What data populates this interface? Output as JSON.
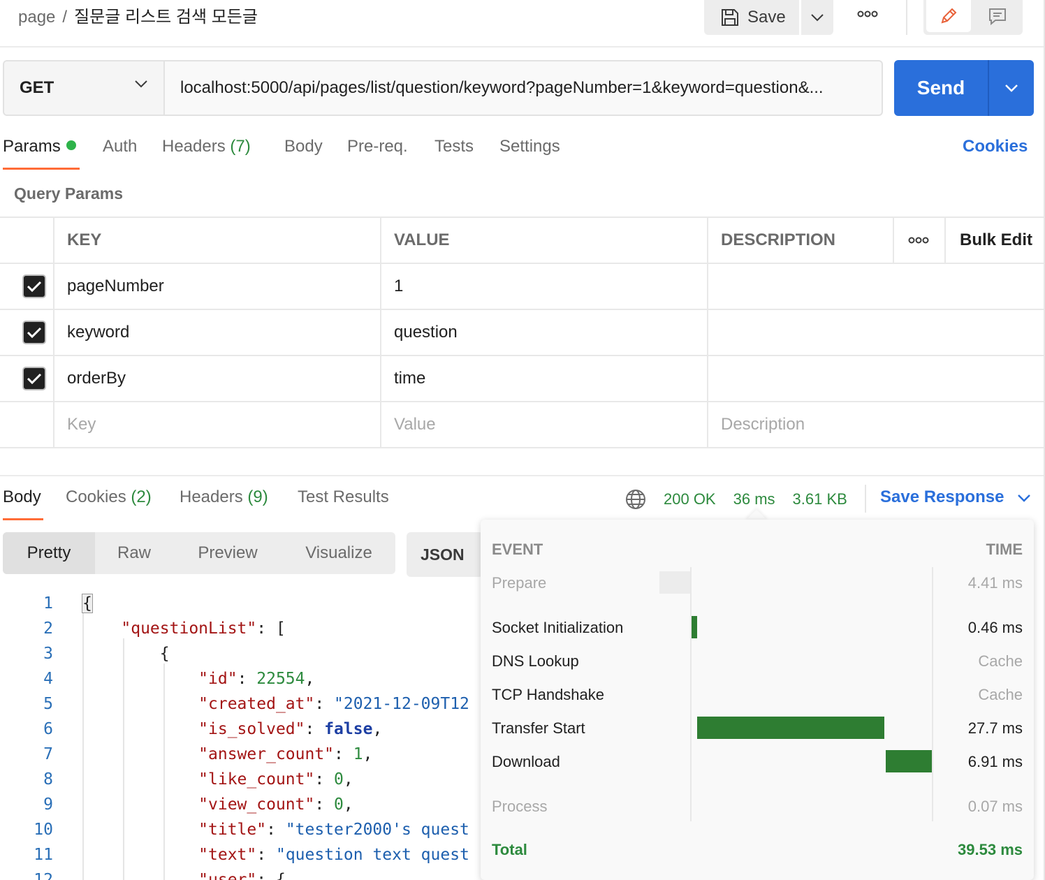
{
  "header": {
    "breadcrumb_root": "page",
    "breadcrumb_sep": "/",
    "request_name": "질문글 리스트 검색 모든글",
    "save_label": "Save"
  },
  "request": {
    "method": "GET",
    "url": "localhost:5000/api/pages/list/question/keyword?pageNumber=1&keyword=question&...",
    "send_label": "Send"
  },
  "request_tabs": {
    "params": "Params",
    "auth": "Auth",
    "headers": "Headers",
    "headers_count": "(7)",
    "body": "Body",
    "prereq": "Pre-req.",
    "tests": "Tests",
    "settings": "Settings",
    "cookies": "Cookies"
  },
  "query_params": {
    "title": "Query Params",
    "headers": {
      "key": "KEY",
      "value": "VALUE",
      "description": "DESCRIPTION",
      "bulk_edit": "Bulk Edit"
    },
    "rows": [
      {
        "key": "pageNumber",
        "value": "1",
        "description": "",
        "checked": true
      },
      {
        "key": "keyword",
        "value": "question",
        "description": "",
        "checked": true
      },
      {
        "key": "orderBy",
        "value": "time",
        "description": "",
        "checked": true
      }
    ],
    "placeholders": {
      "key": "Key",
      "value": "Value",
      "description": "Description"
    }
  },
  "response_tabs": {
    "body": "Body",
    "cookies": "Cookies",
    "cookies_count": "(2)",
    "headers": "Headers",
    "headers_count": "(9)",
    "test_results": "Test Results"
  },
  "response_status": {
    "status": "200 OK",
    "time": "36 ms",
    "size": "3.61 KB",
    "save_response": "Save Response"
  },
  "format_tabs": {
    "pretty": "Pretty",
    "raw": "Raw",
    "preview": "Preview",
    "visualize": "Visualize",
    "language": "JSON"
  },
  "code_lines": [
    {
      "n": "1"
    },
    {
      "n": "2"
    },
    {
      "n": "3"
    },
    {
      "n": "4"
    },
    {
      "n": "5"
    },
    {
      "n": "6"
    },
    {
      "n": "7"
    },
    {
      "n": "8"
    },
    {
      "n": "9"
    },
    {
      "n": "10"
    },
    {
      "n": "11"
    },
    {
      "n": "12"
    }
  ],
  "code": {
    "k_questionList": "\"questionList\"",
    "k_id": "\"id\"",
    "v_id": "22554",
    "k_created_at": "\"created_at\"",
    "v_created_at": "\"2021-12-09T12",
    "k_is_solved": "\"is_solved\"",
    "v_is_solved": "false",
    "k_answer_count": "\"answer_count\"",
    "v_answer_count": "1",
    "k_like_count": "\"like_count\"",
    "v_like_count": "0",
    "k_view_count": "\"view_count\"",
    "v_view_count": "0",
    "k_title": "\"title\"",
    "v_title": "\"tester2000's quest",
    "k_text": "\"text\"",
    "v_text": "\"question text quest",
    "k_user": "\"user\""
  },
  "timing": {
    "event_header": "EVENT",
    "time_header": "TIME",
    "events": [
      {
        "name": "Prepare",
        "time": "4.41 ms"
      },
      {
        "name": "Socket Initialization",
        "time": "0.46 ms"
      },
      {
        "name": "DNS Lookup",
        "time": "Cache"
      },
      {
        "name": "TCP Handshake",
        "time": "Cache"
      },
      {
        "name": "Transfer Start",
        "time": "27.7 ms"
      },
      {
        "name": "Download",
        "time": "6.91 ms"
      },
      {
        "name": "Process",
        "time": "0.07 ms"
      }
    ],
    "total_label": "Total",
    "total_time": "39.53 ms"
  },
  "colors": {
    "accent_send": "#2a6fdb",
    "tab_underline": "#ff6c37",
    "status_green": "#2d8a3e",
    "timing_bar": "#2e7d32"
  }
}
